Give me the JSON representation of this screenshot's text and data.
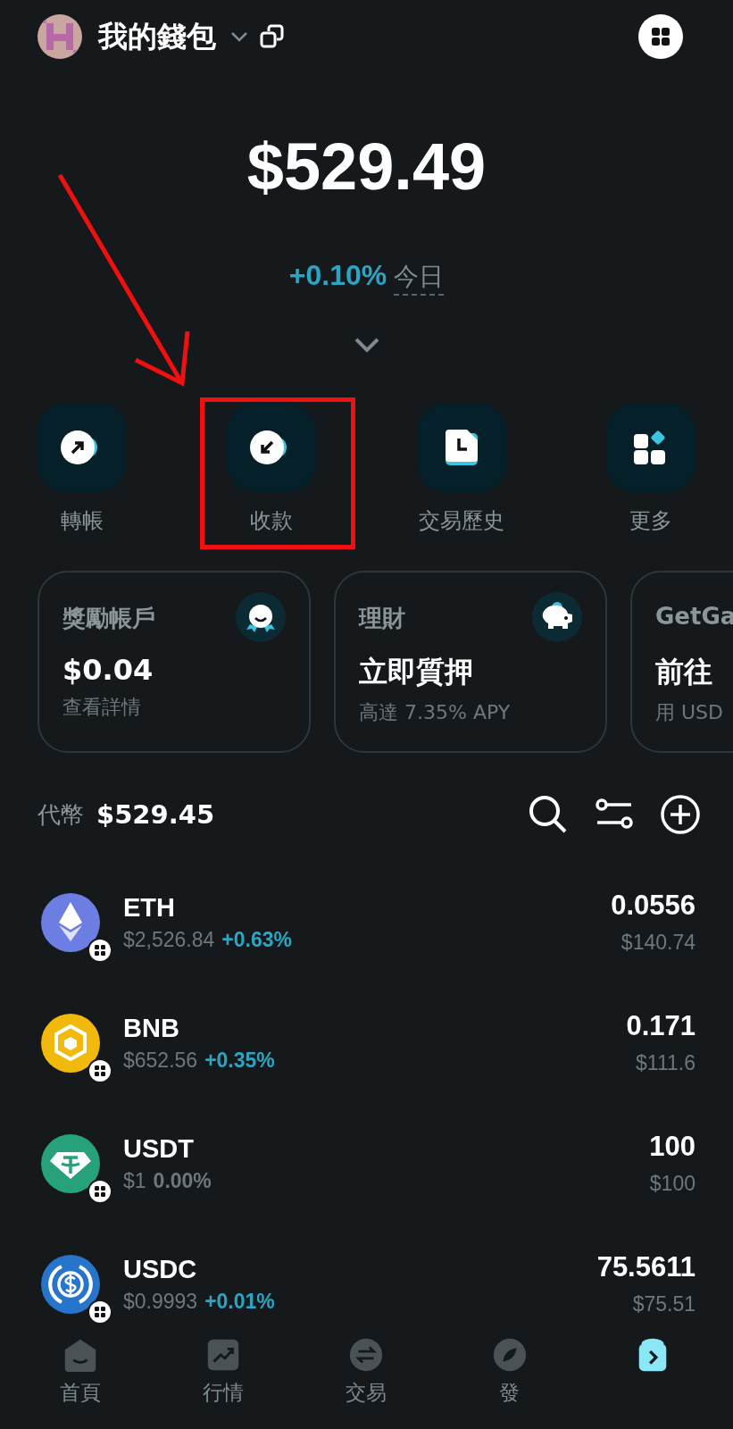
{
  "header": {
    "wallet_name": "我的錢包"
  },
  "balance": {
    "amount": "$529.49",
    "change": "+0.10%",
    "period": "今日"
  },
  "actions": [
    {
      "kind": "send",
      "label": "轉帳",
      "highlighted": false
    },
    {
      "kind": "receive",
      "label": "收款",
      "highlighted": true
    },
    {
      "kind": "history",
      "label": "交易歷史",
      "highlighted": false
    },
    {
      "kind": "more",
      "label": "更多",
      "highlighted": false
    }
  ],
  "cards": [
    {
      "kind": "reward",
      "title": "獎勵帳戶",
      "value": "$0.04",
      "subtitle": "查看詳情"
    },
    {
      "kind": "earn",
      "title": "理財",
      "value": "立即質押",
      "subtitle": "高達 7.35% APY"
    },
    {
      "kind": "none",
      "title": "GetGa",
      "value": "前往",
      "subtitle": "用 USD"
    }
  ],
  "tokens_header": {
    "label": "代幣",
    "total": "$529.45"
  },
  "tokens": [
    {
      "kind": "eth",
      "symbol": "ETH",
      "price": "$2,526.84",
      "change": "+0.63%",
      "color": "#2aa6c4",
      "amount": "0.0556",
      "value": "$140.74"
    },
    {
      "kind": "bnb",
      "symbol": "BNB",
      "price": "$652.56",
      "change": "+0.35%",
      "color": "#2aa6c4",
      "amount": "0.171",
      "value": "$111.6"
    },
    {
      "kind": "usdt",
      "symbol": "USDT",
      "price": "$1",
      "change": "0.00%",
      "color": "#6c787c",
      "amount": "100",
      "value": "$100"
    },
    {
      "kind": "usdc",
      "symbol": "USDC",
      "price": "$0.9993",
      "change": "+0.01%",
      "color": "#2aa6c4",
      "amount": "75.5611",
      "value": "$75.51"
    }
  ],
  "tabs": [
    {
      "kind": "home",
      "label": "首頁",
      "selected": false
    },
    {
      "kind": "market",
      "label": "行情",
      "selected": false
    },
    {
      "kind": "swap",
      "label": "交易",
      "selected": false
    },
    {
      "kind": "discover",
      "label": "發",
      "selected": false
    },
    {
      "kind": "portal",
      "selected": true
    }
  ]
}
